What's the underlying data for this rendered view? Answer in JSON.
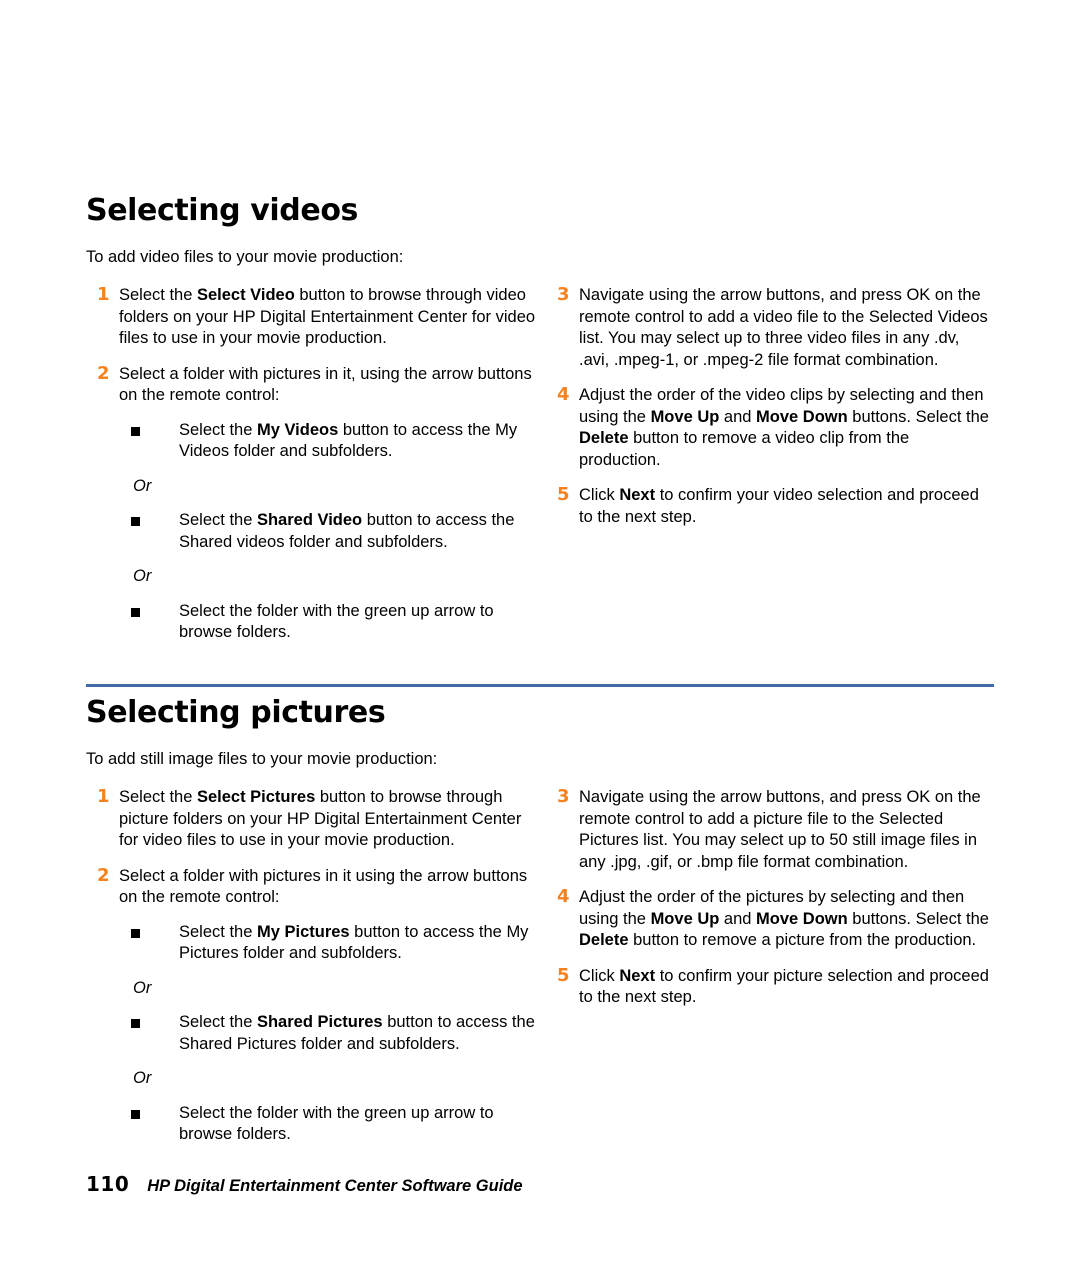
{
  "document": {
    "page_number": "110",
    "footer_title": "HP Digital Entertainment Center Software Guide",
    "accent_number_color": "#f5821f",
    "rule_color": "#3f6ca5",
    "bullet_color": "#000000",
    "background_color": "#ffffff"
  },
  "sections": [
    {
      "id": "selecting-videos",
      "title": "Selecting videos",
      "intro": "To add video files to your movie production:",
      "left_column": {
        "steps": [
          {
            "number": "1",
            "parts": [
              {
                "text": "Select the ",
                "bold": false
              },
              {
                "text": "Select Video",
                "bold": true
              },
              {
                "text": " button to browse through video folders on your HP Digital Entertainment Center for video files to use in your movie production.",
                "bold": false
              }
            ]
          },
          {
            "number": "2",
            "parts": [
              {
                "text": "Select a folder with pictures in it, using the arrow buttons on the remote control:",
                "bold": false
              }
            ],
            "sub_items": [
              {
                "type": "bullet",
                "parts": [
                  {
                    "text": "Select the ",
                    "bold": false
                  },
                  {
                    "text": "My Videos",
                    "bold": true
                  },
                  {
                    "text": " button to access the My Videos folder and subfolders.",
                    "bold": false
                  }
                ]
              },
              {
                "type": "or",
                "text": "Or"
              },
              {
                "type": "bullet",
                "parts": [
                  {
                    "text": "Select the ",
                    "bold": false
                  },
                  {
                    "text": "Shared Video",
                    "bold": true
                  },
                  {
                    "text": " button to access the Shared videos folder and subfolders.",
                    "bold": false
                  }
                ]
              },
              {
                "type": "or",
                "text": "Or"
              },
              {
                "type": "bullet",
                "parts": [
                  {
                    "text": "Select the folder with the green up arrow to browse folders.",
                    "bold": false
                  }
                ]
              }
            ]
          }
        ]
      },
      "right_column": {
        "steps": [
          {
            "number": "3",
            "parts": [
              {
                "text": "Navigate using the arrow buttons, and press OK on the remote control to add a video file to the Selected Videos list. You may select up to three video files in any .dv, .avi, .mpeg-1, or .mpeg-2 file format combination.",
                "bold": false
              }
            ]
          },
          {
            "number": "4",
            "parts": [
              {
                "text": "Adjust the order of the video clips by selecting and then using the ",
                "bold": false
              },
              {
                "text": "Move Up",
                "bold": true
              },
              {
                "text": " and ",
                "bold": false
              },
              {
                "text": "Move Down",
                "bold": true
              },
              {
                "text": " buttons. Select the ",
                "bold": false
              },
              {
                "text": "Delete",
                "bold": true
              },
              {
                "text": " button to remove a video clip from the production.",
                "bold": false
              }
            ]
          },
          {
            "number": "5",
            "parts": [
              {
                "text": "Click ",
                "bold": false
              },
              {
                "text": "Next",
                "bold": true
              },
              {
                "text": " to confirm your video selection and proceed to the next step.",
                "bold": false
              }
            ]
          }
        ]
      }
    },
    {
      "id": "selecting-pictures",
      "title": "Selecting pictures",
      "intro": "To add still image files to your movie production:",
      "left_column": {
        "steps": [
          {
            "number": "1",
            "parts": [
              {
                "text": "Select the ",
                "bold": false
              },
              {
                "text": "Select Pictures",
                "bold": true
              },
              {
                "text": " button to browse through picture folders on your HP Digital Entertainment Center for video files to use in your movie production.",
                "bold": false
              }
            ]
          },
          {
            "number": "2",
            "parts": [
              {
                "text": "Select a folder with pictures in it using the arrow buttons on the remote control:",
                "bold": false
              }
            ],
            "sub_items": [
              {
                "type": "bullet",
                "parts": [
                  {
                    "text": "Select the ",
                    "bold": false
                  },
                  {
                    "text": "My Pictures",
                    "bold": true
                  },
                  {
                    "text": " button to access the My Pictures folder and subfolders.",
                    "bold": false
                  }
                ]
              },
              {
                "type": "or",
                "text": "Or"
              },
              {
                "type": "bullet",
                "parts": [
                  {
                    "text": "Select the ",
                    "bold": false
                  },
                  {
                    "text": "Shared Pictures",
                    "bold": true
                  },
                  {
                    "text": " button to access the Shared Pictures folder and subfolders.",
                    "bold": false
                  }
                ]
              },
              {
                "type": "or",
                "text": "Or"
              },
              {
                "type": "bullet",
                "parts": [
                  {
                    "text": "Select the folder with the green up arrow to browse folders.",
                    "bold": false
                  }
                ]
              }
            ]
          }
        ]
      },
      "right_column": {
        "steps": [
          {
            "number": "3",
            "parts": [
              {
                "text": "Navigate using the arrow buttons, and press OK on the remote control to add a picture file to the Selected Pictures list. You may select up to 50 still image files in any .jpg, .gif, or .bmp file format combination.",
                "bold": false
              }
            ]
          },
          {
            "number": "4",
            "parts": [
              {
                "text": "Adjust the order of the pictures by selecting and then using the ",
                "bold": false
              },
              {
                "text": "Move Up",
                "bold": true
              },
              {
                "text": " and ",
                "bold": false
              },
              {
                "text": "Move Down",
                "bold": true
              },
              {
                "text": " buttons. Select the ",
                "bold": false
              },
              {
                "text": "Delete",
                "bold": true
              },
              {
                "text": " button to remove a picture from the production.",
                "bold": false
              }
            ]
          },
          {
            "number": "5",
            "parts": [
              {
                "text": "Click ",
                "bold": false
              },
              {
                "text": "Next",
                "bold": true
              },
              {
                "text": " to confirm your picture selection and proceed to the next step.",
                "bold": false
              }
            ]
          }
        ]
      }
    }
  ]
}
